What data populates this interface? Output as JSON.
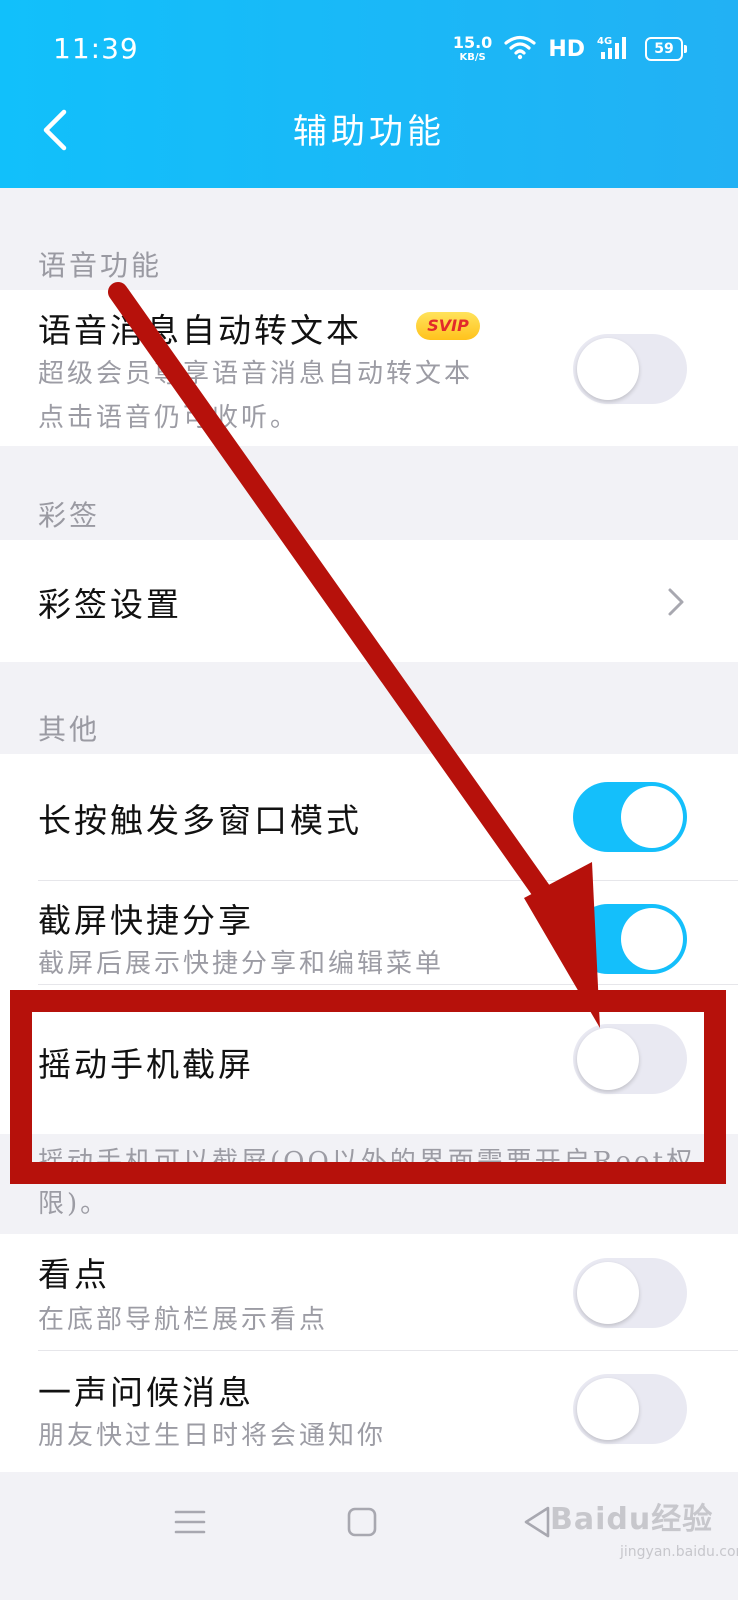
{
  "status_bar": {
    "time": "11:39",
    "net_speed_value": "15.0",
    "net_speed_unit": "KB/S",
    "hd": "HD",
    "signal": "4G",
    "battery": "59"
  },
  "header": {
    "title": "辅助功能",
    "back_icon": "chevron-left-icon",
    "color": "#15bdfa"
  },
  "sections": {
    "voice": {
      "title": "语音功能",
      "row": {
        "title": "语音消息自动转文本",
        "badge": "SVIP",
        "desc_line1": "超级会员尊享语音消息自动转文本",
        "desc_line2": "点击语音仍可收听。",
        "toggle_on": false
      }
    },
    "caiqian": {
      "title": "彩签",
      "row": {
        "title": "彩签设置"
      }
    },
    "other": {
      "title": "其他",
      "rows": [
        {
          "title": "长按触发多窗口模式",
          "toggle_on": true
        },
        {
          "title": "截屏快捷分享",
          "desc": "截屏后展示快捷分享和编辑菜单",
          "toggle_on": true
        },
        {
          "title": "摇动手机截屏",
          "toggle_on": false
        }
      ],
      "footnote_line1": "摇动手机可以截屏(QQ以外的界面需要开启Root权",
      "footnote_line2": "限)。"
    },
    "more": {
      "rows": [
        {
          "title": "看点",
          "desc": "在底部导航栏展示看点",
          "toggle_on": false
        },
        {
          "title": "一声问候消息",
          "desc": "朋友快过生日时将会通知你",
          "toggle_on": false
        }
      ]
    }
  },
  "bottom_nav": {
    "menu_icon": "menu-icon",
    "home_icon": "home-square-icon",
    "back_icon": "back-triangle-icon"
  },
  "watermark": {
    "text": "Baidu经验",
    "sub": "jingyan.baidu.com"
  },
  "annotation": {
    "color": "#b6110b"
  }
}
